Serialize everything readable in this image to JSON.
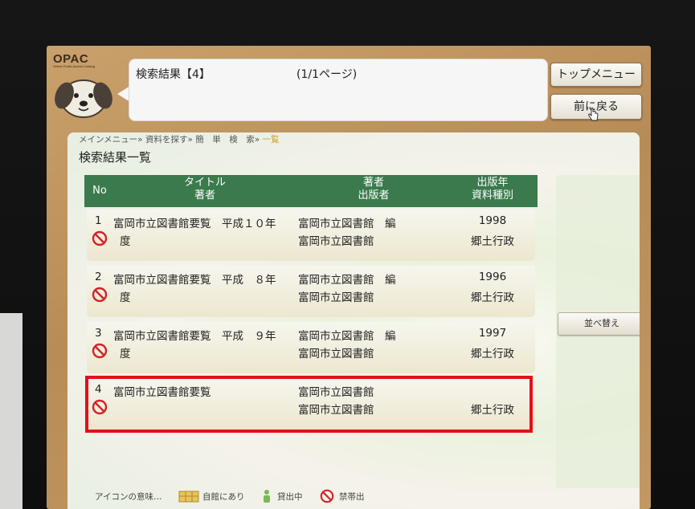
{
  "opac": {
    "logo": "OPAC",
    "subtitle": "Online Public Access Catalog"
  },
  "bubble": {
    "title": "検索結果【4】",
    "page": "(1/1ページ)"
  },
  "buttons": {
    "top_menu": "トップメニュー",
    "back": "前に戻る",
    "sort": "並べ替え"
  },
  "breadcrumb": {
    "path": "メインメニュー» 資料を探す» 簡　単　検　索» ",
    "current": "一覧"
  },
  "heading": "検索結果一覧",
  "table": {
    "headers": {
      "no": "No",
      "title": "タイトル",
      "author": "著者",
      "author2": "著者",
      "publisher": "出版者",
      "year": "出版年",
      "type": "資料種別"
    },
    "rows": [
      {
        "no": "1",
        "title": "富岡市立図書館要覧　平成１０年",
        "title2": "度",
        "author": "富岡市立図書館　編",
        "publisher": "富岡市立図書館",
        "year": "1998",
        "type": "郷土行政"
      },
      {
        "no": "2",
        "title": "富岡市立図書館要覧　平成　８年",
        "title2": "度",
        "author": "富岡市立図書館　編",
        "publisher": "富岡市立図書館",
        "year": "1996",
        "type": "郷土行政"
      },
      {
        "no": "3",
        "title": "富岡市立図書館要覧　平成　９年",
        "title2": "度",
        "author": "富岡市立図書館　編",
        "publisher": "富岡市立図書館",
        "year": "1997",
        "type": "郷土行政"
      },
      {
        "no": "4",
        "title": "富岡市立図書館要覧",
        "title2": "",
        "author": "富岡市立図書館",
        "publisher": "富岡市立図書館",
        "year": "",
        "type": "郷土行政"
      }
    ]
  },
  "legend": {
    "label": "アイコンの意味…",
    "in_library": "自館にあり",
    "on_loan": "貸出中",
    "no_loan": "禁帯出"
  },
  "colors": {
    "header_green": "#3a7a4c",
    "ban_red": "#d2232a",
    "highlight_red": "#e3101a",
    "frame_tan": "#c29863"
  }
}
